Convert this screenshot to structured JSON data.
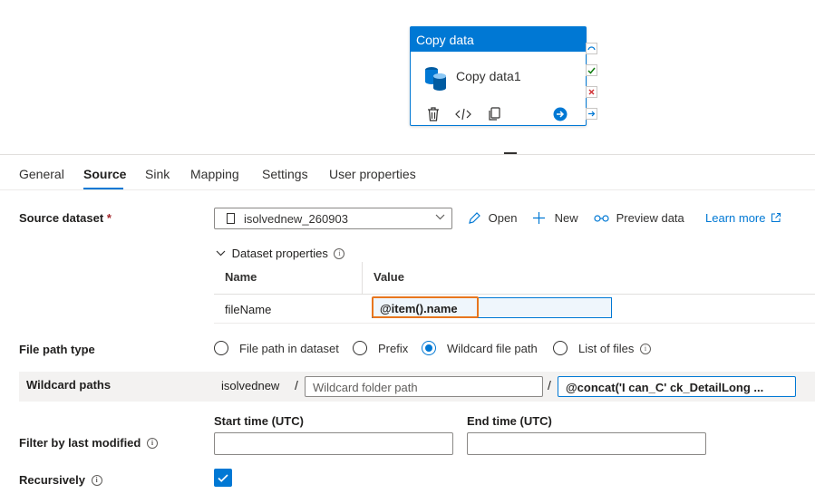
{
  "activity": {
    "header": "Copy data",
    "name": "Copy data1",
    "icons": [
      "database-icon",
      "delete-icon",
      "code-icon",
      "copy-icon",
      "go-arrow-icon"
    ],
    "ports": [
      "skip-port-icon",
      "success-port-icon",
      "failure-port-icon",
      "completion-port-icon"
    ]
  },
  "tabs": [
    {
      "label": "General"
    },
    {
      "label": "Source"
    },
    {
      "label": "Sink"
    },
    {
      "label": "Mapping"
    },
    {
      "label": "Settings"
    },
    {
      "label": "User properties"
    }
  ],
  "active_tab": "Source",
  "source": {
    "dataset_label": "Source dataset",
    "required_mark": "*",
    "dataset_value": "isolvednew_260903",
    "actions": {
      "open": "Open",
      "new": "New",
      "preview": "Preview data",
      "learn_more": "Learn more"
    },
    "dataset_properties": {
      "label": "Dataset properties",
      "columns": [
        "Name",
        "Value"
      ],
      "rows": [
        {
          "name": "fileName",
          "value": "@item().name"
        }
      ]
    },
    "file_path_type": {
      "label": "File path type",
      "options": [
        "File path in dataset",
        "Prefix",
        "Wildcard file path",
        "List of files"
      ],
      "selected": "Wildcard file path"
    },
    "wildcard": {
      "label": "Wildcard paths",
      "container": "isolvednew",
      "separator": "/",
      "folder_placeholder": "Wildcard folder path",
      "file_value": "@concat('I     can_C'   ck_DetailLong ..."
    },
    "filter": {
      "label": "Filter by last modified",
      "start_label": "Start time (UTC)",
      "end_label": "End time (UTC)",
      "start_value": "",
      "end_value": ""
    },
    "recursively": {
      "label": "Recursively",
      "checked": true
    }
  },
  "colors": {
    "accent": "#0078d4",
    "highlight": "#e8761e",
    "required": "#a4262c"
  }
}
